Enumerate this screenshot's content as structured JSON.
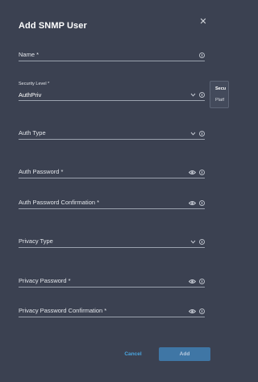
{
  "dialog": {
    "title": "Add SNMP User",
    "close_icon": "close-icon"
  },
  "fields": {
    "name": {
      "label": "Name *"
    },
    "security_level": {
      "label": "Security Level *",
      "value": "AuthPriv"
    },
    "auth_type": {
      "label": "Auth Type"
    },
    "auth_password": {
      "label": "Auth Password *"
    },
    "auth_password_confirmation": {
      "label": "Auth Password Confirmation *"
    },
    "privacy_type": {
      "label": "Privacy Type"
    },
    "privacy_password": {
      "label": "Privacy Password *"
    },
    "privacy_password_confirmation": {
      "label": "Privacy Password Confirmation *"
    }
  },
  "tooltip": {
    "line1": "Secu",
    "line2": "Platf"
  },
  "buttons": {
    "cancel": "Cancel",
    "add": "Add"
  },
  "colors": {
    "background": "#3b4151",
    "accent": "#4aa6e0",
    "primary_button": "#3f76a5"
  }
}
